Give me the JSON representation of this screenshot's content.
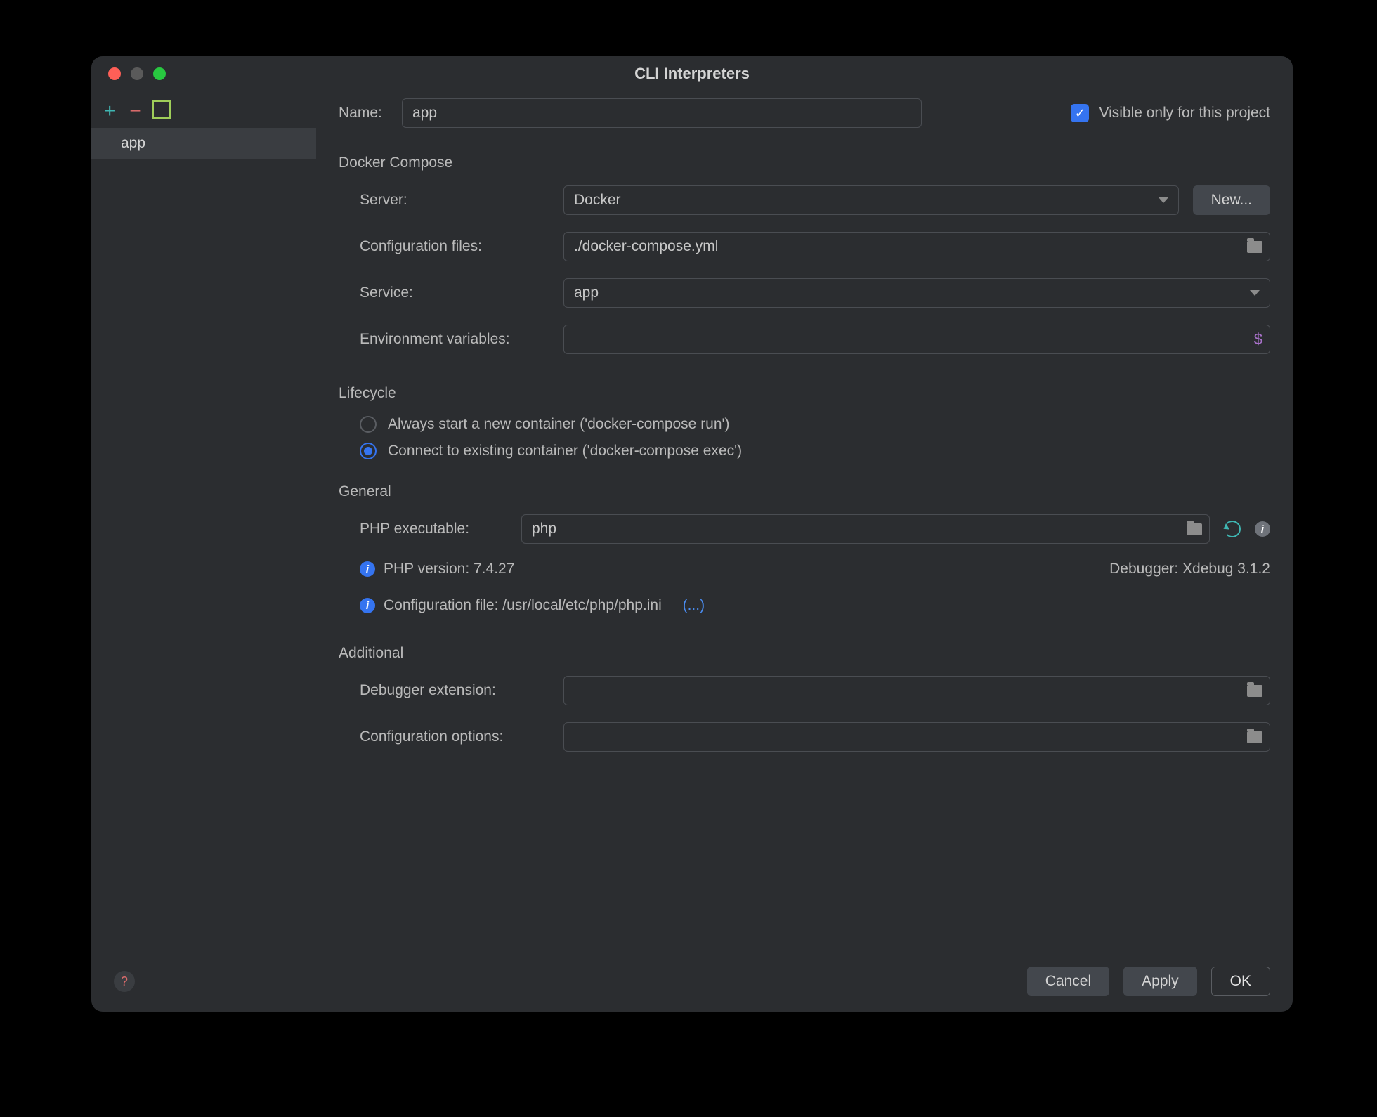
{
  "title": "CLI Interpreters",
  "sidebar": {
    "items": [
      {
        "label": "app"
      }
    ]
  },
  "name": {
    "label": "Name:",
    "value": "app",
    "visible_checkbox_label": "Visible only for this project",
    "visible_checked": true
  },
  "docker_compose": {
    "section": "Docker Compose",
    "server_label": "Server:",
    "server_value": "Docker",
    "new_button": "New...",
    "config_label": "Configuration files:",
    "config_value": "./docker-compose.yml",
    "service_label": "Service:",
    "service_value": "app",
    "env_label": "Environment variables:",
    "env_value": ""
  },
  "lifecycle": {
    "section": "Lifecycle",
    "option_run": "Always start a new container ('docker-compose run')",
    "option_exec": "Connect to existing container ('docker-compose exec')",
    "selected": "exec"
  },
  "general": {
    "section": "General",
    "php_exec_label": "PHP executable:",
    "php_exec_value": "php",
    "php_version_label": "PHP version: 7.4.27",
    "debugger_label": "Debugger:  Xdebug 3.1.2",
    "config_file_label": "Configuration file: /usr/local/etc/php/php.ini",
    "config_more": "(...)"
  },
  "additional": {
    "section": "Additional",
    "debugger_ext_label": "Debugger extension:",
    "debugger_ext_value": "",
    "config_opts_label": "Configuration options:",
    "config_opts_value": ""
  },
  "footer": {
    "cancel": "Cancel",
    "apply": "Apply",
    "ok": "OK"
  }
}
